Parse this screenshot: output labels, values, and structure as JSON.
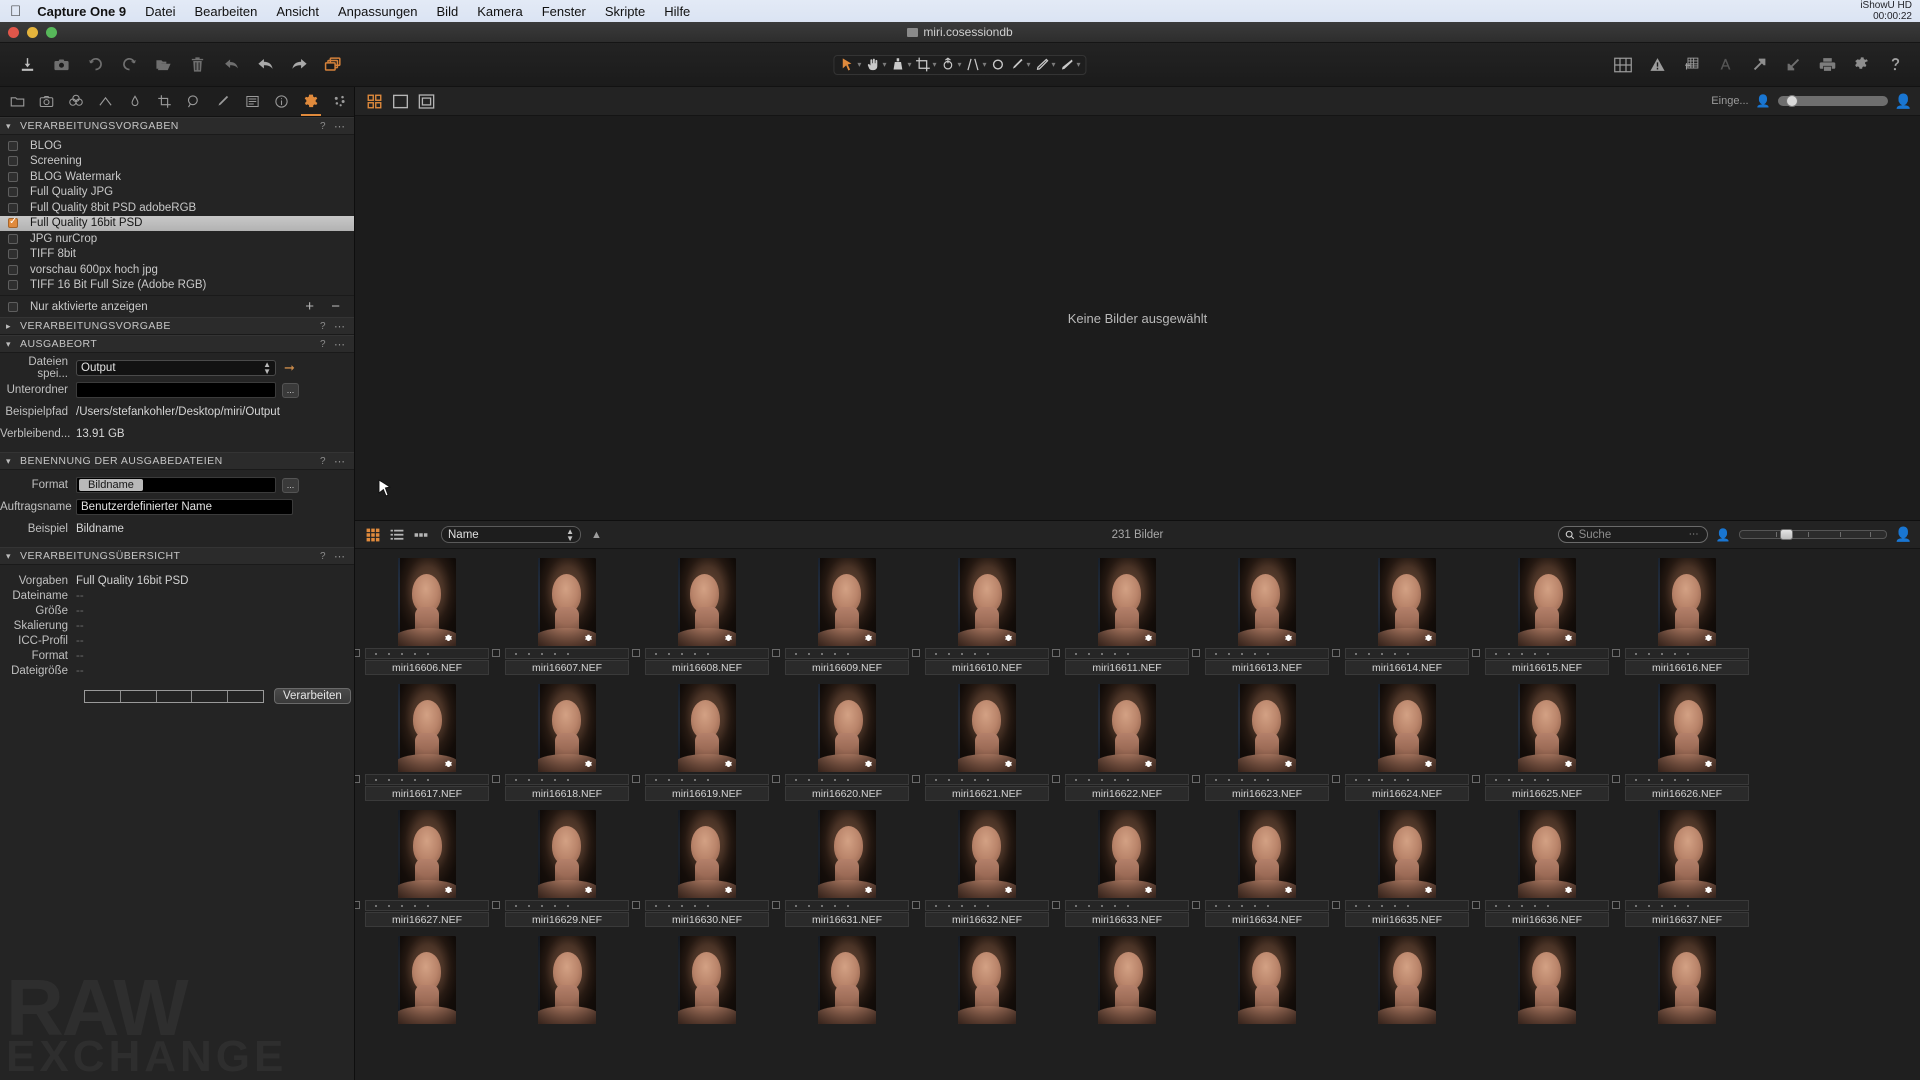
{
  "menubar": {
    "apple_icon": "apple-icon",
    "app_name": "Capture One 9",
    "items": [
      "Datei",
      "Bearbeiten",
      "Ansicht",
      "Anpassungen",
      "Bild",
      "Kamera",
      "Fenster",
      "Skripte",
      "Hilfe"
    ],
    "status_app": "iShowU HD",
    "status_time": "00:00:22"
  },
  "titlebar": {
    "title": "miri.cosessiondb"
  },
  "toolbar": {
    "left_tools": [
      {
        "name": "import-icon",
        "label": "Importieren"
      },
      {
        "name": "capture-icon",
        "label": "Aufnahme"
      },
      {
        "name": "rotate-ccw-icon",
        "label": "Nach links drehen"
      },
      {
        "name": "rotate-cw-icon",
        "label": "Nach rechts drehen"
      },
      {
        "name": "open-folder-icon",
        "label": "Ordner öffnen"
      },
      {
        "name": "trash-icon",
        "label": "Papierkorb"
      },
      {
        "name": "reset-icon",
        "label": "Zurücksetzen"
      },
      {
        "name": "undo-icon",
        "label": "Rückgängig"
      },
      {
        "name": "redo-icon",
        "label": "Wiederholen"
      },
      {
        "name": "variants-icon",
        "label": "Varianten"
      }
    ],
    "center_tools": [
      {
        "name": "pointer-tool-icon",
        "label": "Auswahl",
        "selected": true
      },
      {
        "name": "pan-tool-icon",
        "label": "Verschieben"
      },
      {
        "name": "white-balance-tool-icon",
        "label": "Weißabgleich"
      },
      {
        "name": "crop-tool-icon",
        "label": "Beschneiden"
      },
      {
        "name": "rotate-tool-icon",
        "label": "Drehen"
      },
      {
        "name": "keystone-tool-icon",
        "label": "Trapezkorrektur"
      },
      {
        "name": "spot-removal-tool-icon",
        "label": "Fleckenentfernung"
      },
      {
        "name": "draw-mask-tool-icon",
        "label": "Maske zeichnen"
      },
      {
        "name": "erase-mask-tool-icon",
        "label": "Maske löschen"
      },
      {
        "name": "gradient-mask-tool-icon",
        "label": "Verlaufsmaske"
      }
    ],
    "right_tools": [
      {
        "name": "grid-view-icon",
        "label": "Raster"
      },
      {
        "name": "exposure-warning-icon",
        "label": "Belichtungswarnung"
      },
      {
        "name": "focus-mask-icon",
        "label": "Fokusmaske"
      },
      {
        "name": "annotations-icon",
        "label": "Beschriftungen"
      },
      {
        "name": "export-arrow-icon",
        "label": "Exportieren"
      },
      {
        "name": "import-arrow-icon",
        "label": "Importieren"
      },
      {
        "name": "print-icon",
        "label": "Drucken"
      },
      {
        "name": "gear-icon",
        "label": "Einstellungen"
      },
      {
        "name": "help-icon",
        "label": "Hilfe"
      }
    ]
  },
  "tool_tabs": [
    {
      "name": "tab-library",
      "icon": "folder-icon",
      "active": false
    },
    {
      "name": "tab-capture",
      "icon": "camera-icon",
      "active": false
    },
    {
      "name": "tab-lens",
      "icon": "lens-icon",
      "active": false
    },
    {
      "name": "tab-color",
      "icon": "color-icon",
      "active": false
    },
    {
      "name": "tab-exposure",
      "icon": "exposure-icon",
      "active": false
    },
    {
      "name": "tab-composition",
      "icon": "crop-icon",
      "active": false
    },
    {
      "name": "tab-details",
      "icon": "magnifier-icon",
      "active": false
    },
    {
      "name": "tab-adjustments",
      "icon": "brush-icon",
      "active": false
    },
    {
      "name": "tab-metadata",
      "icon": "list-icon",
      "active": false
    },
    {
      "name": "tab-info",
      "icon": "info-icon",
      "active": false
    },
    {
      "name": "tab-output",
      "icon": "gear-icon",
      "active": true
    },
    {
      "name": "tab-batch",
      "icon": "batch-icon",
      "active": false
    }
  ],
  "output_panel": {
    "presets_section": {
      "title": "VERARBEITUNGSVORGABEN",
      "help": "?",
      "menu": "⋯",
      "items": [
        {
          "label": "BLOG",
          "checked": false,
          "selected": false
        },
        {
          "label": "Screening",
          "checked": false,
          "selected": false
        },
        {
          "label": "BLOG Watermark",
          "checked": false,
          "selected": false
        },
        {
          "label": "Full Quality JPG",
          "checked": false,
          "selected": false
        },
        {
          "label": "Full Quality 8bit PSD adobeRGB",
          "checked": false,
          "selected": false
        },
        {
          "label": "Full Quality 16bit PSD",
          "checked": true,
          "selected": true
        },
        {
          "label": "JPG nurCrop",
          "checked": false,
          "selected": false
        },
        {
          "label": "TIFF 8bit",
          "checked": false,
          "selected": false
        },
        {
          "label": "vorschau  600px hoch jpg",
          "checked": false,
          "selected": false
        },
        {
          "label": "TIFF 16 Bit Full Size (Adobe RGB)",
          "checked": false,
          "selected": false
        }
      ],
      "show_only_enabled_label": "Nur aktivierte anzeigen",
      "show_only_enabled_checked": false,
      "add_button": "+",
      "remove_button": "–"
    },
    "recipe_section": {
      "title": "VERARBEITUNGSVORGABE",
      "collapsed": true
    },
    "location_section": {
      "title": "AUSGABEORT",
      "collapsed": false,
      "save_to_label": "Dateien spei...",
      "save_to_value": "Output",
      "subfolder_label": "Unterordner",
      "subfolder_value": "",
      "sample_path_label": "Beispielpfad",
      "sample_path_value": "/Users/stefankohler/Desktop/miri/Output",
      "remaining_label": "Verbleibend...",
      "remaining_value": "13.91 GB",
      "browse_button": "..."
    },
    "naming_section": {
      "title": "BENENNUNG DER AUSGABEDATEIEN",
      "format_label": "Format",
      "format_token": "Bildname",
      "job_name_label": "Auftragsname",
      "job_name_value": "Benutzerdefinierter Name",
      "example_label": "Beispiel",
      "example_value": "Bildname",
      "browse_button": "..."
    },
    "summary_section": {
      "title": "VERARBEITUNGSÜBERSICHT",
      "rows": [
        {
          "label": "Vorgaben",
          "value": "Full Quality 16bit PSD"
        },
        {
          "label": "Dateiname",
          "value": "--"
        },
        {
          "label": "Größe",
          "value": "--"
        },
        {
          "label": "Skalierung",
          "value": "--"
        },
        {
          "label": "ICC-Profil",
          "value": "--"
        },
        {
          "label": "Format",
          "value": "--"
        },
        {
          "label": "Dateigröße",
          "value": "--"
        }
      ],
      "process_button": "Verarbeiten"
    }
  },
  "watermark": {
    "line1": "RAW",
    "line2": "EXCHANGE"
  },
  "viewer": {
    "modes": [
      {
        "name": "multi-view-icon",
        "active": true
      },
      {
        "name": "single-view-icon",
        "active": false
      },
      {
        "name": "proof-view-icon",
        "active": false
      }
    ],
    "empty_message": "Keine Bilder ausgewählt",
    "zoom_label": "Einge...",
    "zoom_min_icon": "person-small-icon",
    "zoom_max_icon": "person-large-icon"
  },
  "browser": {
    "view_modes": [
      {
        "name": "grid-view-icon",
        "active": true
      },
      {
        "name": "list-view-icon",
        "active": false
      },
      {
        "name": "filmstrip-view-icon",
        "active": false
      }
    ],
    "sort_value": "Name",
    "sort_direction_icon": "sort-ascending-icon",
    "image_count": "231 Bilder",
    "search_placeholder": "Suche",
    "search_icon": "search-icon",
    "search_menu": "⋯",
    "thumb_size_min_icon": "person-small-icon",
    "thumb_size_max_icon": "person-large-icon",
    "rows": [
      [
        "miri16606.NEF",
        "miri16607.NEF",
        "miri16608.NEF",
        "miri16609.NEF",
        "miri16610.NEF",
        "miri16611.NEF",
        "miri16613.NEF",
        "miri16614.NEF",
        "miri16615.NEF",
        "miri16616.NEF"
      ],
      [
        "miri16617.NEF",
        "miri16618.NEF",
        "miri16619.NEF",
        "miri16620.NEF",
        "miri16621.NEF",
        "miri16622.NEF",
        "miri16623.NEF",
        "miri16624.NEF",
        "miri16625.NEF",
        "miri16626.NEF"
      ],
      [
        "miri16627.NEF",
        "miri16629.NEF",
        "miri16630.NEF",
        "miri16631.NEF",
        "miri16632.NEF",
        "miri16633.NEF",
        "miri16634.NEF",
        "miri16635.NEF",
        "miri16636.NEF",
        "miri16637.NEF"
      ],
      [
        "",
        "",
        "",
        "",
        "",
        "",
        "",
        "",
        "",
        ""
      ]
    ]
  },
  "colors": {
    "accent": "#e08a3c",
    "panel_bg": "#242424",
    "app_bg": "#1f1f1f",
    "menubar_bg": "#dbe4f3"
  }
}
